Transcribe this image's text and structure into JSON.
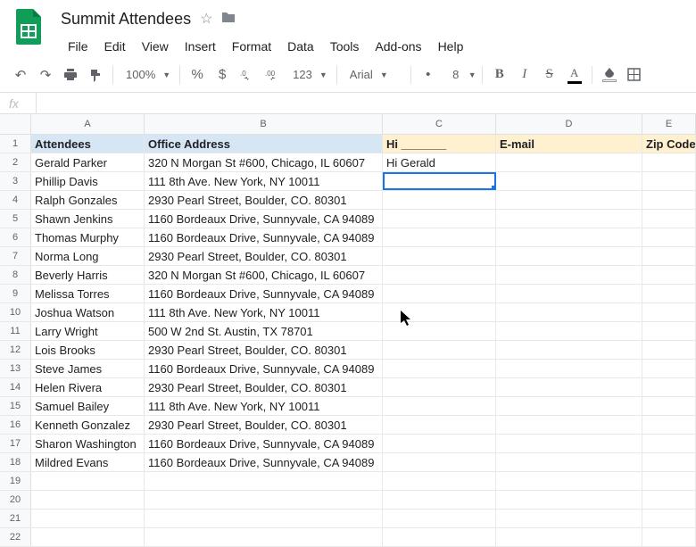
{
  "doc": {
    "title": "Summit Attendees"
  },
  "menus": [
    "File",
    "Edit",
    "View",
    "Insert",
    "Format",
    "Data",
    "Tools",
    "Add-ons",
    "Help"
  ],
  "toolbar": {
    "zoom": "100%",
    "number_format": "123",
    "font": "Arial",
    "font_size": "8"
  },
  "columns": [
    {
      "letter": "A",
      "width_class": "col-A"
    },
    {
      "letter": "B",
      "width_class": "col-B"
    },
    {
      "letter": "C",
      "width_class": "col-C"
    },
    {
      "letter": "D",
      "width_class": "col-D"
    },
    {
      "letter": "E",
      "width_class": "col-E"
    }
  ],
  "header_row": {
    "A": "Attendees",
    "B": "Office Address",
    "C": "Hi _______",
    "D": "E-mail",
    "E": "Zip Code"
  },
  "data_rows": [
    {
      "A": "Gerald Parker",
      "B": "320 N Morgan St #600, Chicago, IL 60607",
      "C": "Hi Gerald"
    },
    {
      "A": "Phillip Davis",
      "B": "111 8th Ave. New York, NY 10011",
      "C": ""
    },
    {
      "A": "Ralph Gonzales",
      "B": "2930 Pearl Street, Boulder, CO. 80301",
      "C": ""
    },
    {
      "A": "Shawn Jenkins",
      "B": "1160 Bordeaux Drive, Sunnyvale, CA 94089",
      "C": ""
    },
    {
      "A": "Thomas Murphy",
      "B": "1160 Bordeaux Drive, Sunnyvale, CA 94089",
      "C": ""
    },
    {
      "A": "Norma Long",
      "B": "2930 Pearl Street, Boulder, CO. 80301",
      "C": ""
    },
    {
      "A": "Beverly Harris",
      "B": "320 N Morgan St #600, Chicago, IL 60607",
      "C": ""
    },
    {
      "A": "Melissa Torres",
      "B": "1160 Bordeaux Drive, Sunnyvale, CA 94089",
      "C": ""
    },
    {
      "A": "Joshua Watson",
      "B": "111 8th Ave. New York, NY 10011",
      "C": ""
    },
    {
      "A": "Larry Wright",
      "B": "500 W 2nd St. Austin, TX 78701",
      "C": ""
    },
    {
      "A": "Lois Brooks",
      "B": "2930 Pearl Street, Boulder, CO. 80301",
      "C": ""
    },
    {
      "A": "Steve James",
      "B": "1160 Bordeaux Drive, Sunnyvale, CA 94089",
      "C": ""
    },
    {
      "A": "Helen Rivera",
      "B": "2930 Pearl Street, Boulder, CO. 80301",
      "C": ""
    },
    {
      "A": "Samuel Bailey",
      "B": "111 8th Ave. New York, NY 10011",
      "C": ""
    },
    {
      "A": "Kenneth Gonzalez",
      "B": "2930 Pearl Street, Boulder, CO. 80301",
      "C": ""
    },
    {
      "A": "Sharon Washington",
      "B": "1160 Bordeaux Drive, Sunnyvale, CA 94089",
      "C": ""
    },
    {
      "A": "Mildred Evans",
      "B": "1160 Bordeaux Drive, Sunnyvale, CA 94089",
      "C": ""
    }
  ],
  "empty_rows": [
    19,
    20,
    21,
    22
  ],
  "selected_cell": "C3",
  "fx_value": ""
}
